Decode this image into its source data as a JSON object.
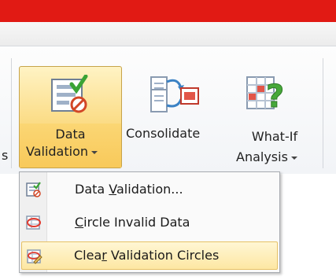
{
  "ribbon": {
    "data_validation": {
      "line1": "Data",
      "line2": "Validation"
    },
    "consolidate": {
      "label": "Consolidate"
    },
    "what_if": {
      "line1": "What-If",
      "line2": "Analysis"
    },
    "partial_left_char": "s"
  },
  "menu": {
    "items": [
      {
        "pre": "Data ",
        "mnemonic": "V",
        "post": "alidation...",
        "icon": "data-validation-icon"
      },
      {
        "pre": "",
        "mnemonic": "C",
        "post": "ircle Invalid Data",
        "icon": "circle-invalid-icon"
      },
      {
        "pre": "Clea",
        "mnemonic": "r",
        "post": " Validation Circles",
        "icon": "clear-circles-icon"
      }
    ]
  },
  "colors": {
    "title_bar": "#e11a14",
    "hover_gold": "#fbdc86",
    "accent_green": "#3aa335"
  }
}
